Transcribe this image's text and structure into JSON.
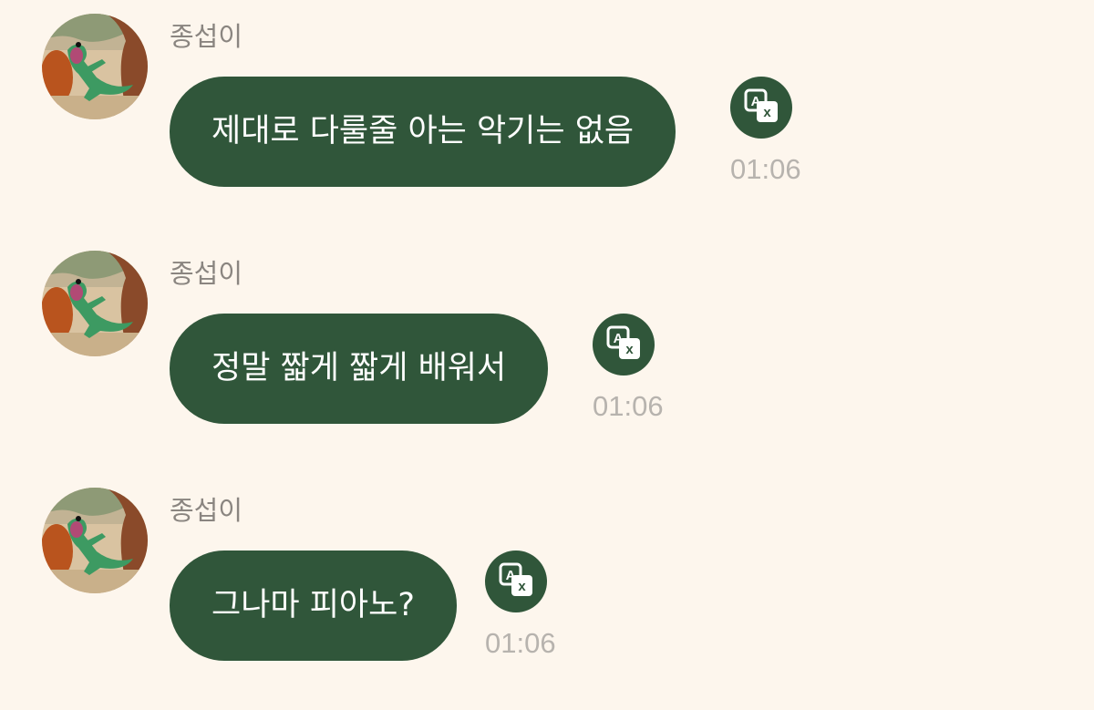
{
  "messages": [
    {
      "sender": "종섭이",
      "text": "제대로 다룰줄 아는 악기는 없음",
      "time": "01:06"
    },
    {
      "sender": "종섭이",
      "text": "정말 짧게 짧게 배워서",
      "time": "01:06"
    },
    {
      "sender": "종섭이",
      "text": "그나마 피아노?",
      "time": "01:06"
    }
  ],
  "colors": {
    "background": "#fdf6ed",
    "bubble": "#30563a",
    "bubble_text": "#ffffff",
    "sender_text": "#8a8580",
    "time_text": "#b7b3ae"
  },
  "icons": {
    "avatar": "cartoon-lizard-avatar",
    "translate": "translate-icon"
  }
}
